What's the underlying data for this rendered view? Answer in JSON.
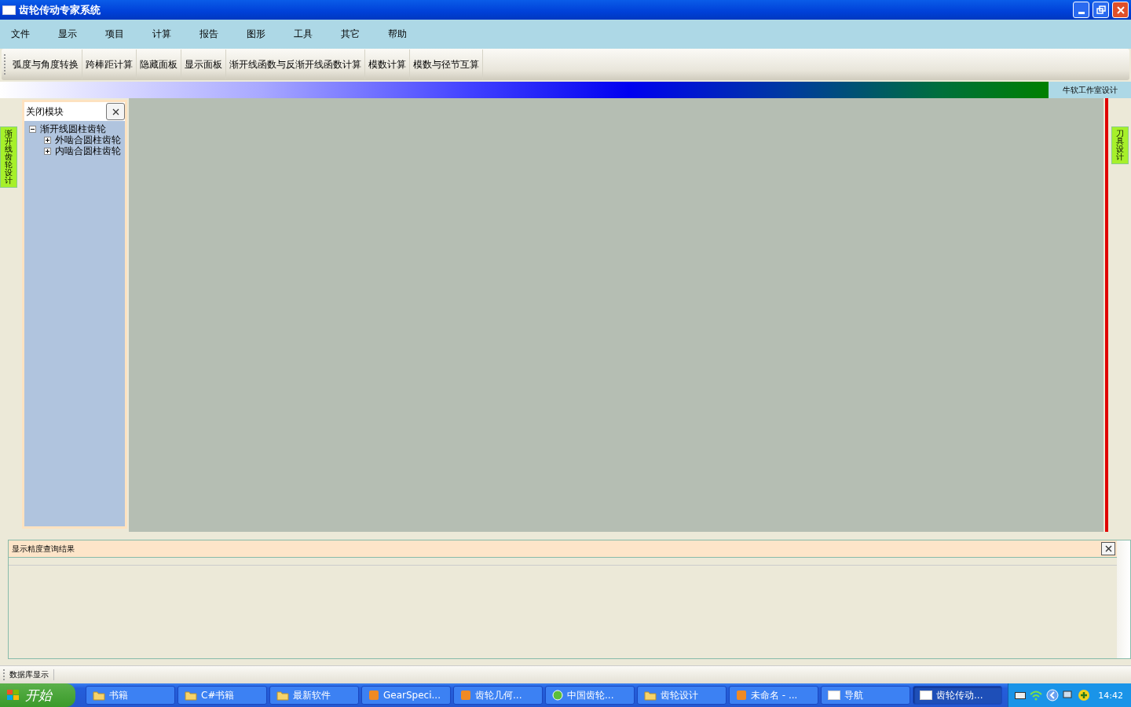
{
  "window": {
    "title": "齿轮传动专家系统"
  },
  "menu": [
    "文件",
    "显示",
    "项目",
    "计算",
    "报告",
    "图形",
    "工具",
    "其它",
    "帮助"
  ],
  "toolbar": [
    "弧度与角度转换",
    "跨棒距计算",
    "隐藏面板",
    "显示面板",
    "渐开线函数与反渐开线函数计算",
    "模数计算",
    "模数与径节互算"
  ],
  "banner": {
    "label": "牛软工作室设计"
  },
  "left_tab": {
    "label": "渐开线齿轮设计"
  },
  "right_tab": {
    "label": "刀具设计"
  },
  "module_panel": {
    "title": "关闭模块",
    "tree": [
      {
        "label": "渐开线圆柱齿轮",
        "expanded": true,
        "children": [
          {
            "label": "外啮合圆柱齿轮",
            "expanded": false
          },
          {
            "label": "内啮合圆柱齿轮",
            "expanded": false
          }
        ]
      }
    ]
  },
  "result_panel": {
    "title": "显示精度查询结果"
  },
  "status_strip": {
    "label": "数据库显示"
  },
  "taskbar": {
    "start": "开始",
    "items": [
      {
        "kind": "folder",
        "label": "书籍",
        "selected": false
      },
      {
        "kind": "folder",
        "label": "C#书籍",
        "selected": false
      },
      {
        "kind": "folder",
        "label": "最新软件",
        "selected": false
      },
      {
        "kind": "app",
        "label": "GearSpeci...",
        "selected": false
      },
      {
        "kind": "app",
        "label": "齿轮几何...",
        "selected": false
      },
      {
        "kind": "browser",
        "label": "中国齿轮...",
        "selected": false
      },
      {
        "kind": "folder",
        "label": "齿轮设计",
        "selected": false
      },
      {
        "kind": "app",
        "label": "未命名 - ...",
        "selected": false
      },
      {
        "kind": "window",
        "label": "导航",
        "selected": false
      },
      {
        "kind": "window",
        "label": "齿轮传动...",
        "selected": true
      }
    ],
    "clock": "14:42"
  }
}
